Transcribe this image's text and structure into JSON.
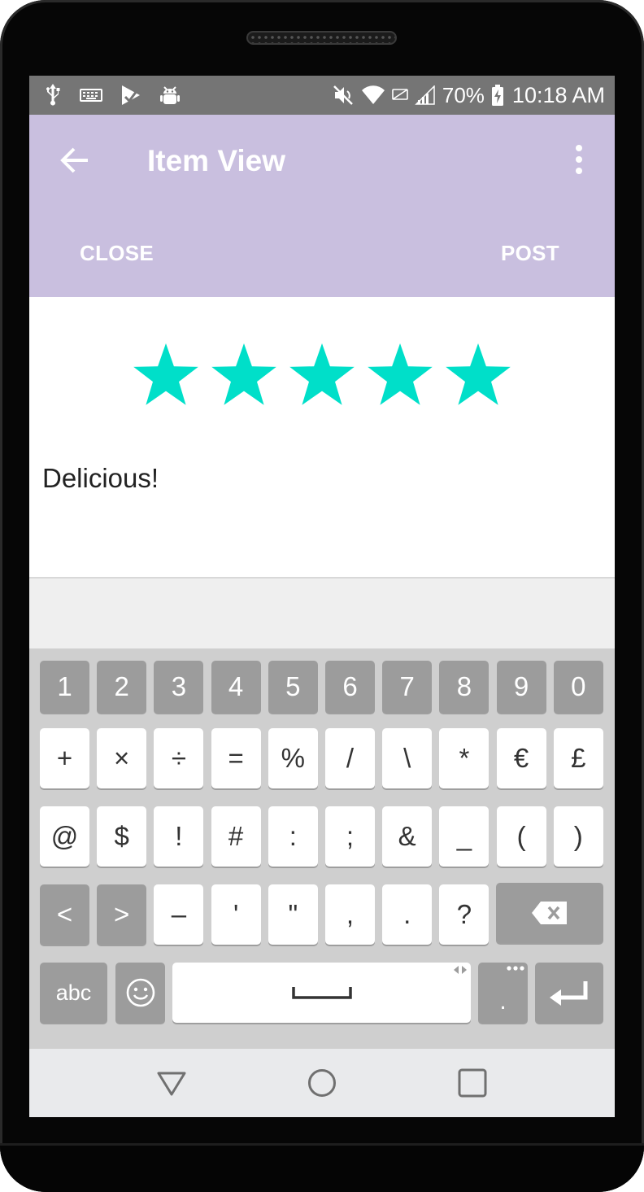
{
  "status_bar": {
    "battery": "70%",
    "time": "10:18 AM"
  },
  "app_bar": {
    "title": "Item View",
    "close_label": "CLOSE",
    "post_label": "POST",
    "background_color": "#c9bfdf"
  },
  "review": {
    "rating": 5,
    "max_rating": 5,
    "star_color": "#00dfc9",
    "text": "Delicious!"
  },
  "keyboard": {
    "row1": [
      "1",
      "2",
      "3",
      "4",
      "5",
      "6",
      "7",
      "8",
      "9",
      "0"
    ],
    "row2": [
      "+",
      "×",
      "÷",
      "=",
      "%",
      "/",
      "\\",
      "*",
      "€",
      "£"
    ],
    "row3": [
      "@",
      "$",
      "!",
      "#",
      ":",
      ";",
      "&",
      "_",
      "(",
      ")"
    ],
    "row4": [
      "<",
      ">",
      "–",
      "'",
      "\"",
      ",",
      ".",
      "?"
    ],
    "abc_label": "abc",
    "period_label": "."
  },
  "icons": {
    "status": [
      "usb-icon",
      "keyboard-icon",
      "play-store-icon",
      "android-debug-icon",
      "mute-icon",
      "wifi-icon",
      "no-sim-icon",
      "signal-icon",
      "battery-icon"
    ],
    "app_bar": [
      "back-arrow-icon",
      "overflow-menu-icon"
    ],
    "keyboard": [
      "backspace-icon",
      "emoji-icon",
      "space-icon",
      "enter-icon"
    ],
    "nav": [
      "nav-back-icon",
      "nav-home-icon",
      "nav-recents-icon"
    ]
  }
}
